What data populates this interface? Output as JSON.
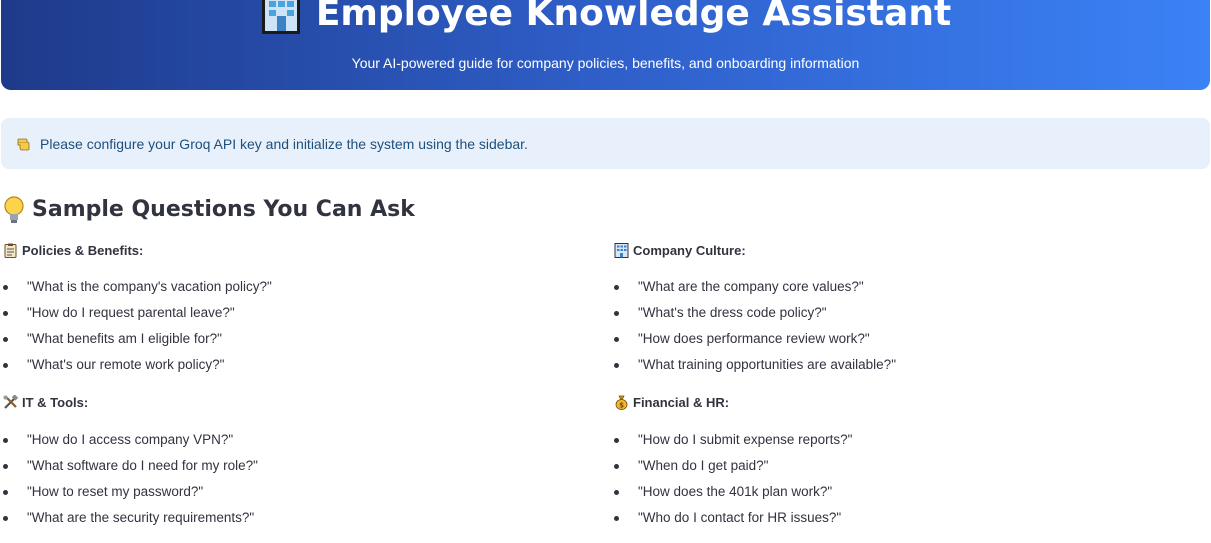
{
  "header": {
    "title": "Employee Knowledge Assistant",
    "subtitle": "Your AI-powered guide for company policies, benefits, and onboarding information",
    "icon": "office-building-icon"
  },
  "info": {
    "icon": "pointing-hand-icon",
    "text": "Please configure your Groq API key and initialize the system using the sidebar."
  },
  "samples": {
    "icon": "lightbulb-icon",
    "title": "Sample Questions You Can Ask",
    "categories": [
      {
        "icon": "clipboard-icon",
        "title": "Policies & Benefits:",
        "questions": [
          "\"What is the company's vacation policy?\"",
          "\"How do I request parental leave?\"",
          "\"What benefits am I eligible for?\"",
          "\"What's our remote work policy?\""
        ]
      },
      {
        "icon": "office-building-icon",
        "title": "Company Culture:",
        "questions": [
          "\"What are the company core values?\"",
          "\"What's the dress code policy?\"",
          "\"How does performance review work?\"",
          "\"What training opportunities are available?\""
        ]
      },
      {
        "icon": "tools-icon",
        "title": "IT & Tools:",
        "questions": [
          "\"How do I access company VPN?\"",
          "\"What software do I need for my role?\"",
          "\"How to reset my password?\"",
          "\"What are the security requirements?\""
        ]
      },
      {
        "icon": "money-bag-icon",
        "title": "Financial & HR:",
        "questions": [
          "\"How do I submit expense reports?\"",
          "\"When do I get paid?\"",
          "\"How does the 401k plan work?\"",
          "\"Who do I contact for HR issues?\""
        ]
      }
    ]
  },
  "colors": {
    "hero_start": "#1e3a8a",
    "hero_end": "#3b82f6",
    "info_bg": "#e8f1fb",
    "info_text": "#1d4f7c",
    "text": "#31333f"
  }
}
